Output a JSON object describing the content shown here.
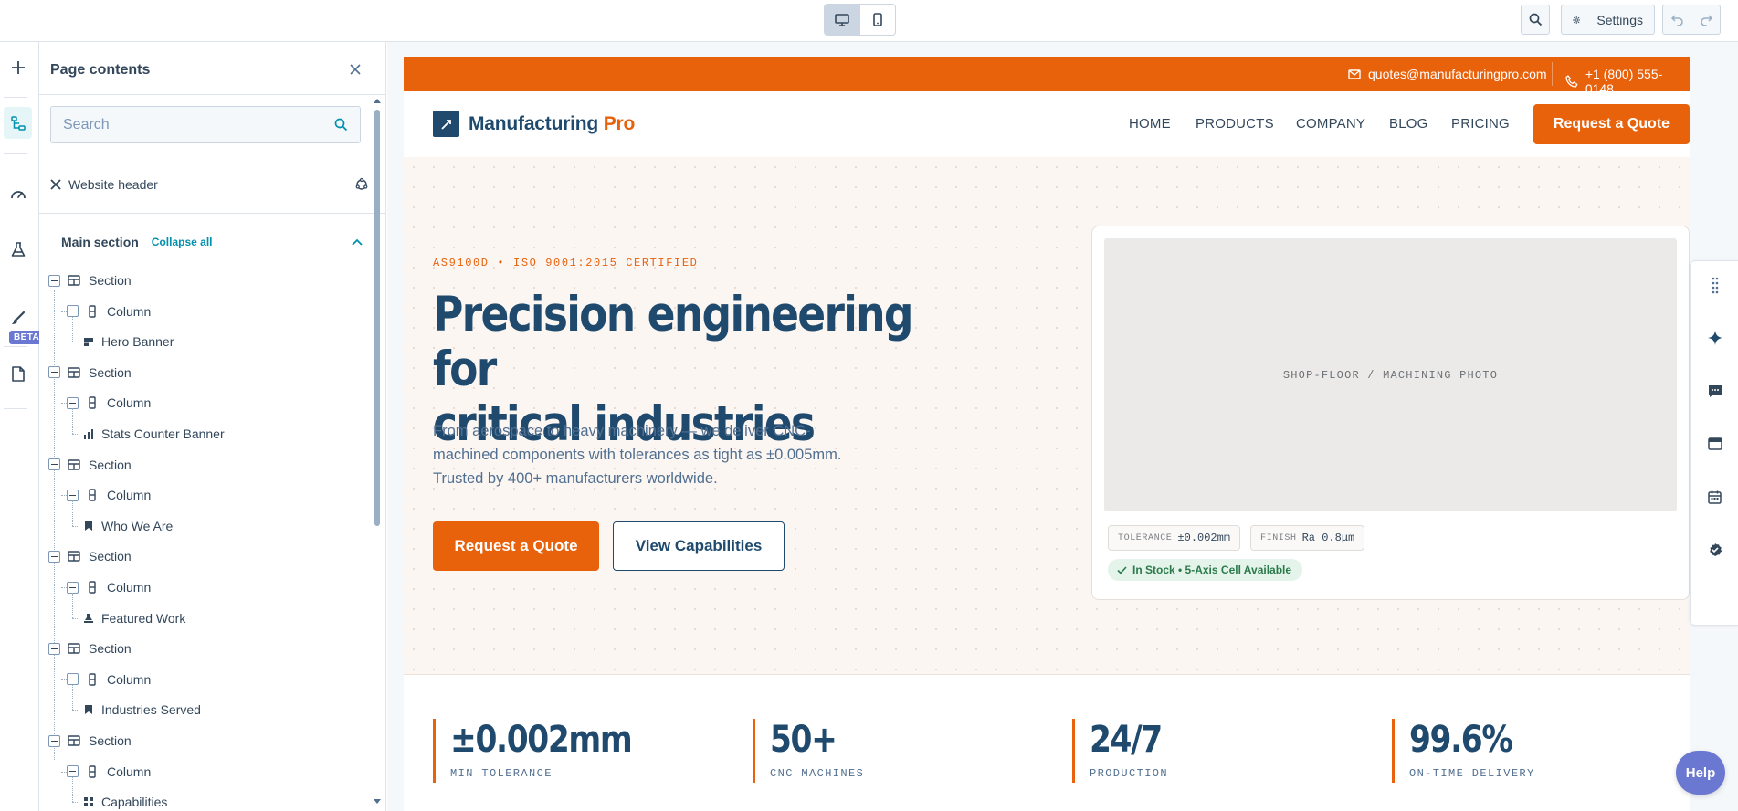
{
  "toolbar": {
    "settings_label": "Settings",
    "icons": [
      "desktop-icon",
      "mobile-icon",
      "search-icon",
      "gear-icon",
      "undo-icon",
      "redo-icon"
    ]
  },
  "rail": {
    "beta_label": "BETA",
    "icons": [
      "plus-icon",
      "tree-icon",
      "gauge-icon",
      "flask-icon",
      "brush-icon",
      "file-icon"
    ]
  },
  "panel": {
    "title": "Page contents",
    "search_placeholder": "Search",
    "website_header": "Website header",
    "main_section": "Main section",
    "collapse_all": "Collapse all",
    "tree": [
      {
        "section": "Section",
        "column": "Column",
        "module": "Hero Banner"
      },
      {
        "section": "Section",
        "column": "Column",
        "module": "Stats Counter Banner"
      },
      {
        "section": "Section",
        "column": "Column",
        "module": "Who We Are"
      },
      {
        "section": "Section",
        "column": "Column",
        "module": "Featured Work"
      },
      {
        "section": "Section",
        "column": "Column",
        "module": "Industries Served"
      },
      {
        "section": "Section",
        "column": "Column",
        "module": "Capabilities"
      }
    ]
  },
  "site": {
    "email": "quotes@manufacturingpro.com",
    "phone": "+1 (800) 555-0148",
    "logo_main": "Manufacturing",
    "logo_accent": "Pro",
    "nav": [
      "HOME",
      "PRODUCTS",
      "COMPANY",
      "BLOG",
      "PRICING"
    ],
    "nav_cta": "Request a Quote",
    "hero": {
      "eyebrow": "AS9100D • ISO 9001:2015 CERTIFIED",
      "headline_line1": "Precision engineering for",
      "headline_line2": "critical industries",
      "lead": "From aerospace to heavy machinery — we deliver CNC-machined components with tolerances as tight as ±0.005mm. Trusted by 400+ manufacturers worldwide.",
      "primary_cta": "Request a Quote",
      "secondary_cta": "View Capabilities",
      "photo_placeholder": "SHOP-FLOOR / MACHINING PHOTO",
      "spec1_key": "TOLERANCE",
      "spec1_value": "±0.002mm",
      "spec2_key": "FINISH",
      "spec2_value": "Ra 0.8μm",
      "stock_badge": "In Stock • 5-Axis Cell Available"
    },
    "stats": [
      {
        "value": "±0.002mm",
        "label": "MIN TOLERANCE"
      },
      {
        "value": "50+",
        "label": "CNC MACHINES"
      },
      {
        "value": "24/7",
        "label": "PRODUCTION"
      },
      {
        "value": "99.6%",
        "label": "ON-TIME DELIVERY"
      }
    ]
  },
  "help_label": "Help",
  "colors": {
    "accent": "#e8610b",
    "brand": "#1f4a6e",
    "link": "#0091ae",
    "beta": "#6a78d1"
  }
}
